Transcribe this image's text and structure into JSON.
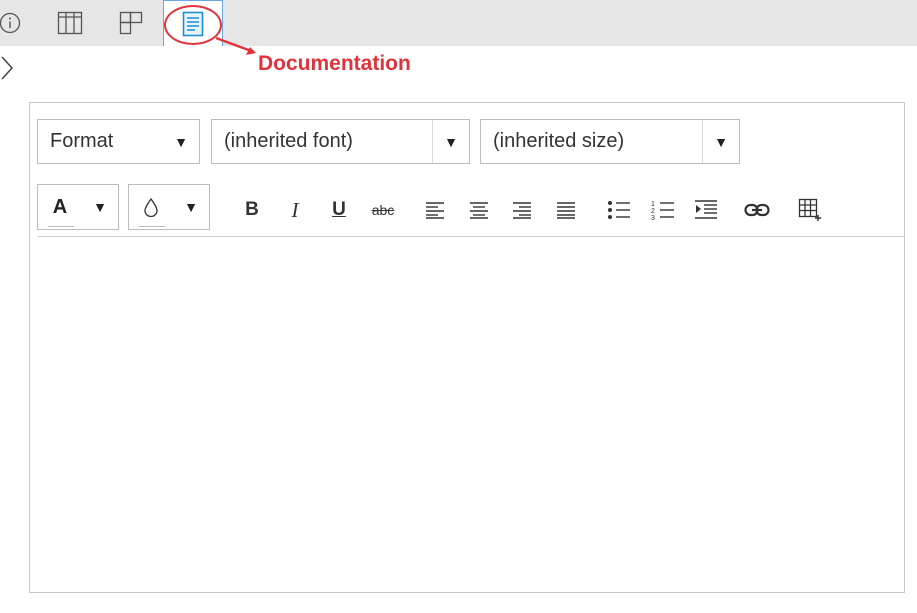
{
  "tabs": [
    {
      "id": "info",
      "icon": "info-icon"
    },
    {
      "id": "columns",
      "icon": "columns-icon"
    },
    {
      "id": "layout",
      "icon": "layout-icon"
    },
    {
      "id": "documentation",
      "icon": "document-icon",
      "selected": true
    }
  ],
  "callout": {
    "label": "Documentation",
    "color": "#e0343c"
  },
  "editor": {
    "format_select": {
      "value": "Format"
    },
    "font_select": {
      "value": "(inherited font)"
    },
    "size_select": {
      "value": "(inherited size)"
    },
    "font_color": {
      "label": "A",
      "icon": "font-color-icon"
    },
    "background_color": {
      "icon": "background-color-icon"
    },
    "buttons": {
      "bold": "B",
      "italic": "I",
      "underline": "U",
      "strikethrough": "abc"
    },
    "body_text": ""
  },
  "colors": {
    "accent": "#1a8fd6",
    "selection_border": "#6aa6e8",
    "tabbar_bg": "#e6e6e6"
  }
}
